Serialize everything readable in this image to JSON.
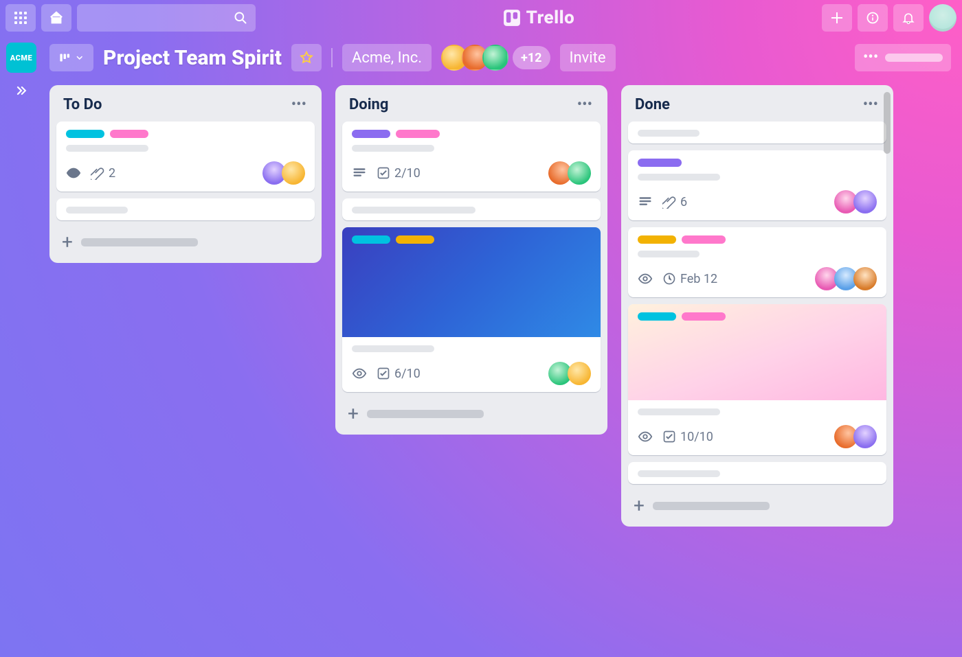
{
  "app": {
    "brand": "Trello"
  },
  "sidebar": {
    "workspace_badge": "ACME"
  },
  "board": {
    "title": "Project Team Spirit",
    "team_label": "Acme, Inc.",
    "extra_members_label": "+12",
    "invite_label": "Invite"
  },
  "lists": [
    {
      "title": "To Do",
      "cards": [
        {
          "labels": [
            "cyan",
            "pink"
          ],
          "attachments": "2",
          "watch": true,
          "members": [
            "d",
            "a"
          ]
        },
        {
          "placeholder": true
        }
      ]
    },
    {
      "title": "Doing",
      "cards": [
        {
          "labels": [
            "purple",
            "pink"
          ],
          "description": true,
          "checklist": "2/10",
          "members": [
            "b",
            "c"
          ]
        },
        {
          "placeholder": true
        },
        {
          "cover": "blue",
          "labels": [
            "cyan",
            "yellow"
          ],
          "watch": true,
          "checklist": "6/10",
          "members": [
            "c",
            "a"
          ]
        }
      ]
    },
    {
      "title": "Done",
      "cards": [
        {
          "placeholder": true
        },
        {
          "labels": [
            "purple"
          ],
          "description": true,
          "attachments": "6",
          "members": [
            "f",
            "d"
          ]
        },
        {
          "labels": [
            "yellow",
            "pink"
          ],
          "watch": true,
          "due": "Feb 12",
          "members": [
            "f",
            "e",
            "g"
          ]
        },
        {
          "cover": "pink",
          "labels": [
            "cyan",
            "pink"
          ],
          "watch": true,
          "checklist": "10/10",
          "members": [
            "b",
            "d"
          ]
        },
        {
          "placeholder": true
        }
      ]
    }
  ]
}
